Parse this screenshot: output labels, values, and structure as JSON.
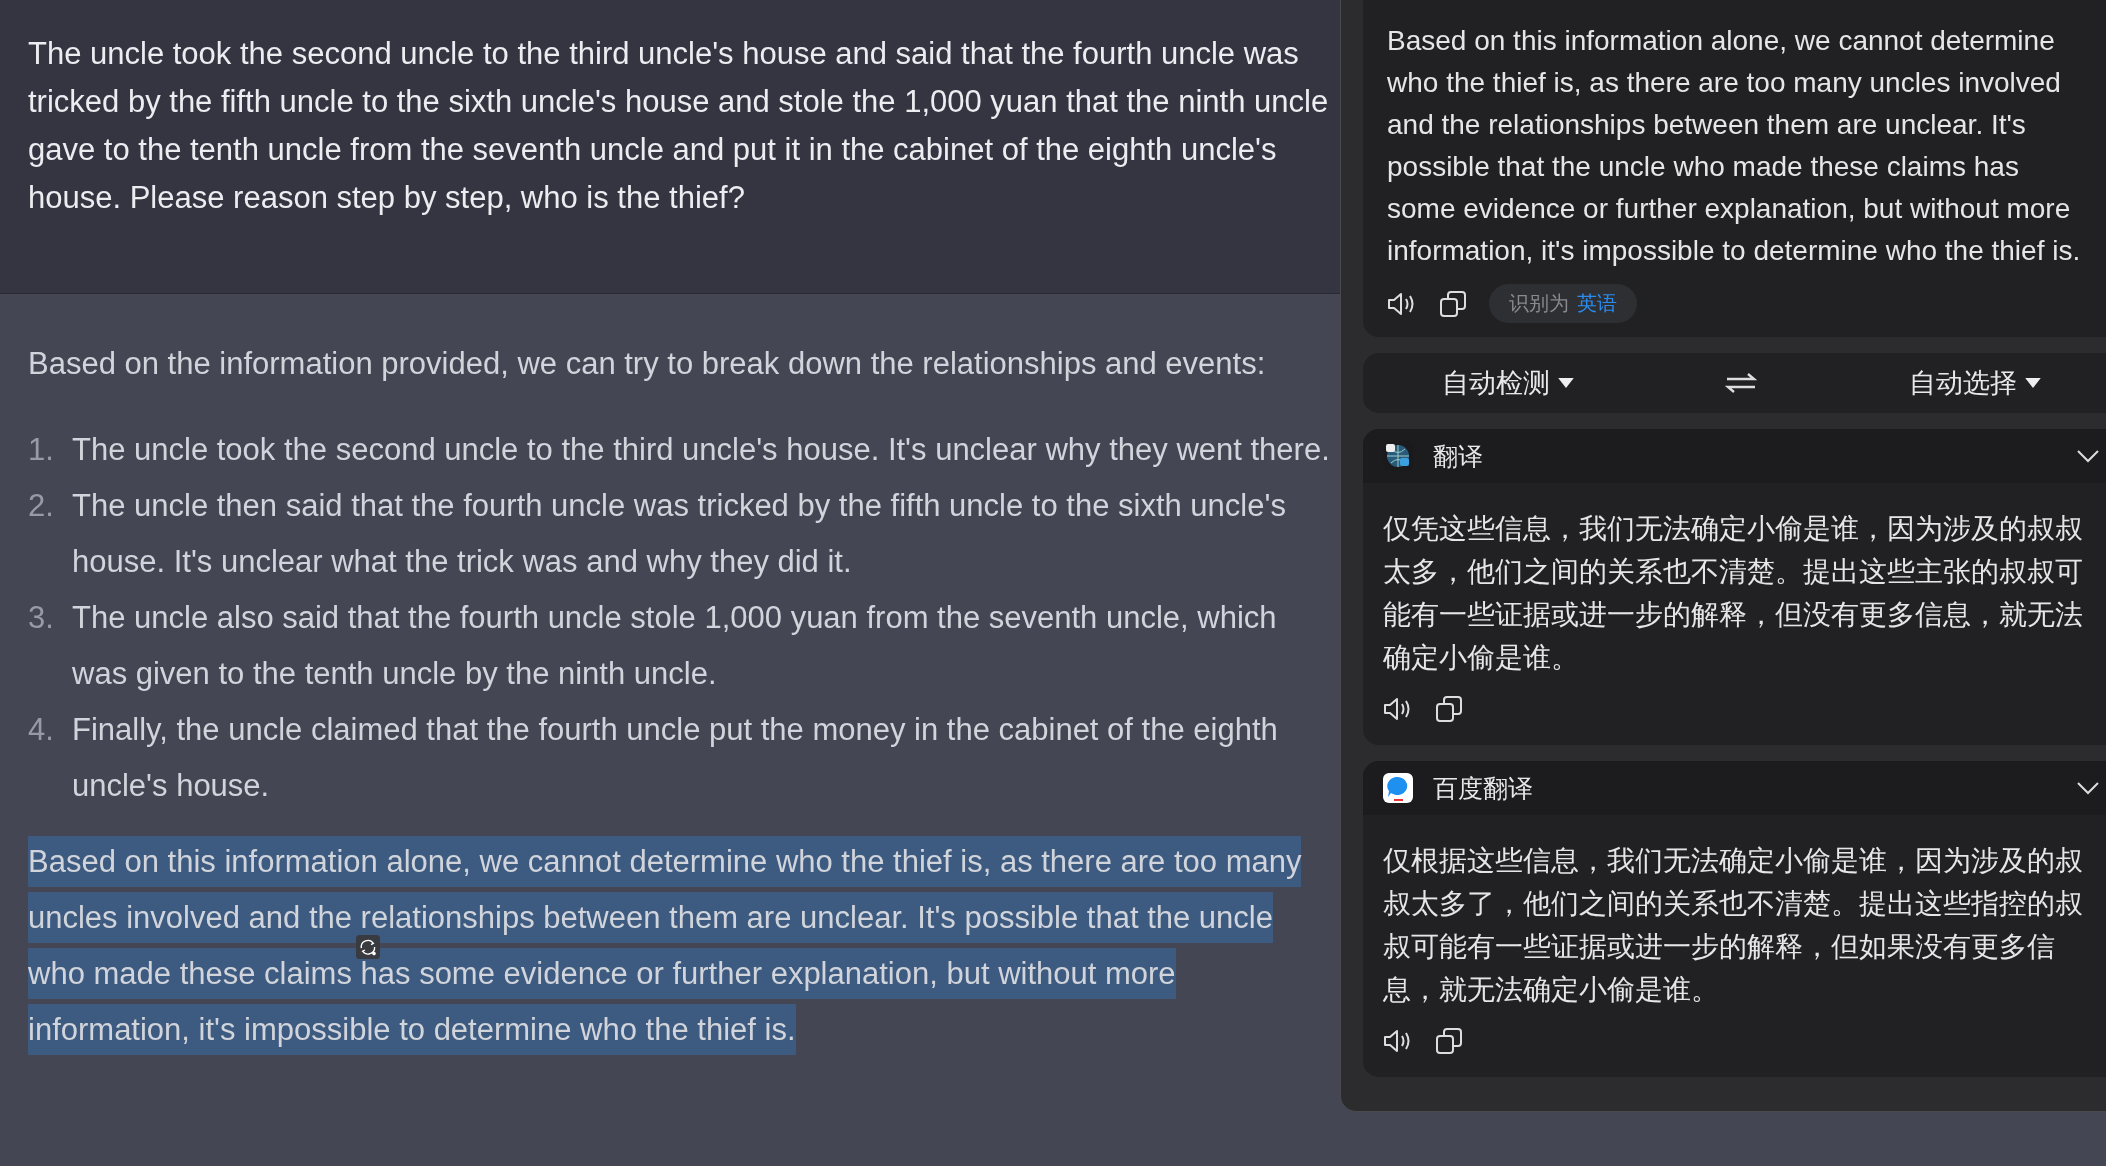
{
  "chat": {
    "user_message": "The uncle took the second uncle to the third uncle's house and said that the fourth uncle was tricked by the fifth uncle to the sixth uncle's house and stole the 1,000 yuan that the ninth uncle gave to the tenth uncle from the seventh uncle and put it in the cabinet of the eighth uncle's house. Please reason step by step, who is the thief?",
    "assistant": {
      "intro": "Based on the information provided, we can try to break down the relationships and events:",
      "steps": [
        {
          "number": "1.",
          "text": "The uncle took the second uncle to the third uncle's house. It's unclear why they went there."
        },
        {
          "number": "2.",
          "text": "The uncle then said that the fourth uncle was tricked by the fifth uncle to the sixth uncle's house. It's unclear what the trick was and why they did it."
        },
        {
          "number": "3.",
          "text": "The uncle also said that the fourth uncle stole 1,000 yuan from the seventh uncle, which was given to the tenth uncle by the ninth uncle."
        },
        {
          "number": "4.",
          "text": "Finally, the uncle claimed that the fourth uncle put the money in the cabinet of the eighth uncle's house."
        }
      ],
      "conclusion": {
        "text": "Based on this information alone, we cannot determine who the thief is, as there are too many uncles involved and the relationships between them are unclear. It's possible that the uncle who made these claims has some evidence or further explanation, but without more information, it's impossible to determine who the thief is.",
        "selected": true
      }
    }
  },
  "translator": {
    "source": {
      "text": "Based on this information alone, we cannot determine who the thief is, as there are too many uncles involved and the relationships between them are unclear. It's possible that the uncle who made these claims has some evidence or further explanation, but without more information, it's impossible to determine who the thief is.",
      "detected_label": "识别为",
      "detected_language": "英语"
    },
    "language_bar": {
      "from": "自动检测",
      "to": "自动选择"
    },
    "results": [
      {
        "name": "翻译",
        "kind": "globe",
        "text": "仅凭这些信息，我们无法确定小偷是谁，因为涉及的叔叔太多，他们之间的关系也不清楚。提出这些主张的叔叔可能有一些证据或进一步的解释，但没有更多信息，就无法确定小偷是谁。"
      },
      {
        "name": "百度翻译",
        "kind": "baidu",
        "text": "仅根据这些信息，我们无法确定小偷是谁，因为涉及的叔叔太多了，他们之间的关系也不清楚。提出这些指控的叔叔可能有一些证据或进一步的解释，但如果没有更多信息，就无法确定小偷是谁。"
      }
    ]
  }
}
